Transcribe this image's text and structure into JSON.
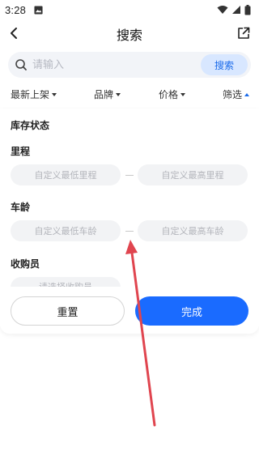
{
  "status_bar": {
    "time": "3:28"
  },
  "header": {
    "title": "搜索"
  },
  "search": {
    "placeholder": "请输入",
    "button_label": "搜索"
  },
  "filters": [
    {
      "label": "最新上架",
      "active": false
    },
    {
      "label": "品牌",
      "active": false
    },
    {
      "label": "价格",
      "active": false
    },
    {
      "label": "筛选",
      "active": true
    }
  ],
  "panel": {
    "stock_status": {
      "title": "库存状态"
    },
    "mileage": {
      "title": "里程",
      "min_placeholder": "自定义最低里程",
      "max_placeholder": "自定义最高里程"
    },
    "age": {
      "title": "车龄",
      "min_placeholder": "自定义最低车龄",
      "max_placeholder": "自定义最高车龄"
    },
    "buyer": {
      "title": "收购员",
      "placeholder_partial": "请选择收购员"
    }
  },
  "actions": {
    "reset_label": "重置",
    "confirm_label": "完成"
  },
  "colors": {
    "accent": "#1a6bff",
    "search_btn_bg": "#d8e7ff",
    "annotation_arrow": "#e0454f"
  }
}
